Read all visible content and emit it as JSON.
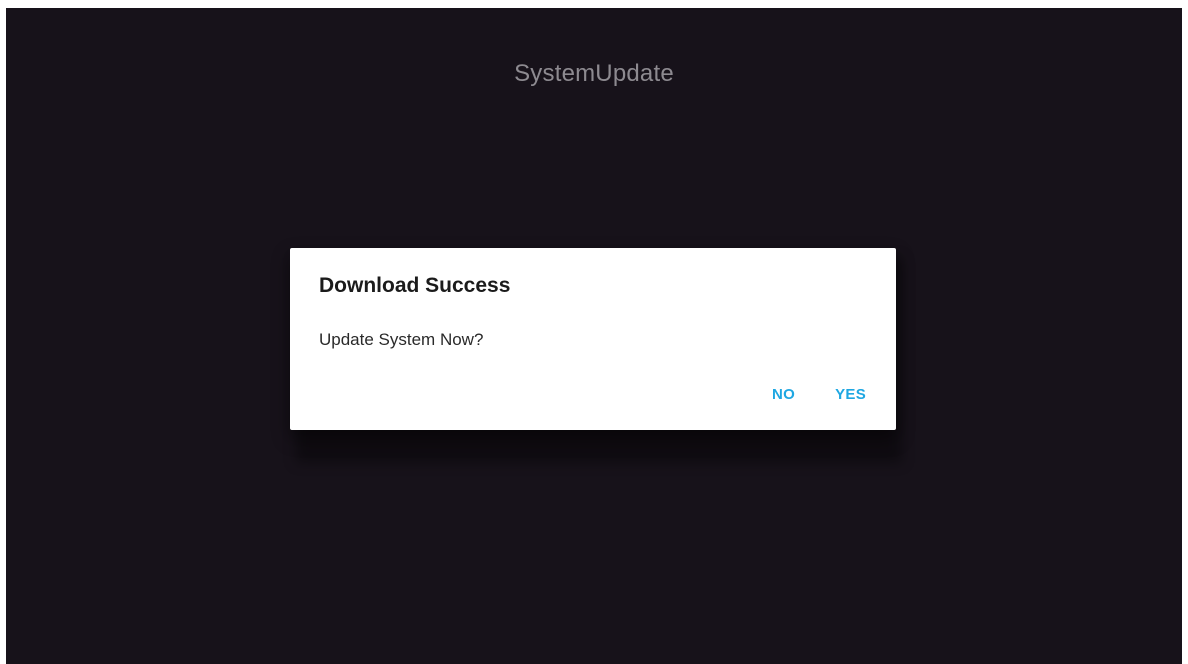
{
  "app": {
    "title": "SystemUpdate"
  },
  "dialog": {
    "title": "Download Success",
    "message": "Update System Now?",
    "buttons": {
      "no_label": "NO",
      "yes_label": "YES"
    }
  },
  "colors": {
    "background": "#17121a",
    "accent": "#1ea7e2",
    "title_text": "#8d8a90",
    "dialog_background": "#ffffff"
  }
}
